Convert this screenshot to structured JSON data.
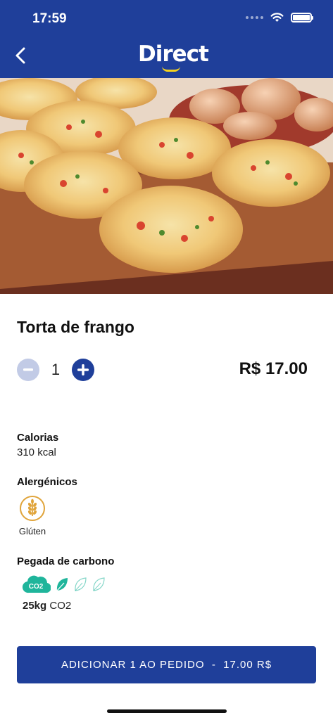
{
  "status_bar": {
    "time": "17:59"
  },
  "header": {
    "brand_name": "Direct",
    "back_icon": "chevron-left-icon",
    "color": "#1f3f9a"
  },
  "product": {
    "name": "Torta de frango",
    "quantity": "1",
    "price": "R$ 17.00",
    "image_description_icon": "quiche-photo"
  },
  "nutrition": {
    "calories_label": "Calorias",
    "calories_value": "310 kcal",
    "allergens_label": "Alergénicos",
    "allergens": [
      {
        "name": "Glúten",
        "icon": "wheat-icon"
      }
    ]
  },
  "carbon": {
    "label": "Pegada de carbono",
    "badge": "CO2",
    "amount": "25kg",
    "unit": "CO2",
    "leaves_filled": 1,
    "leaves_total": 3,
    "color": "#1fb59b"
  },
  "actions": {
    "add_to_order": "ADICIONAR 1 AO PEDIDO  -  17.00 R$"
  },
  "colors": {
    "primary": "#1f3f9a",
    "accent": "#f4d21e",
    "allergen": "#e0a43a"
  }
}
